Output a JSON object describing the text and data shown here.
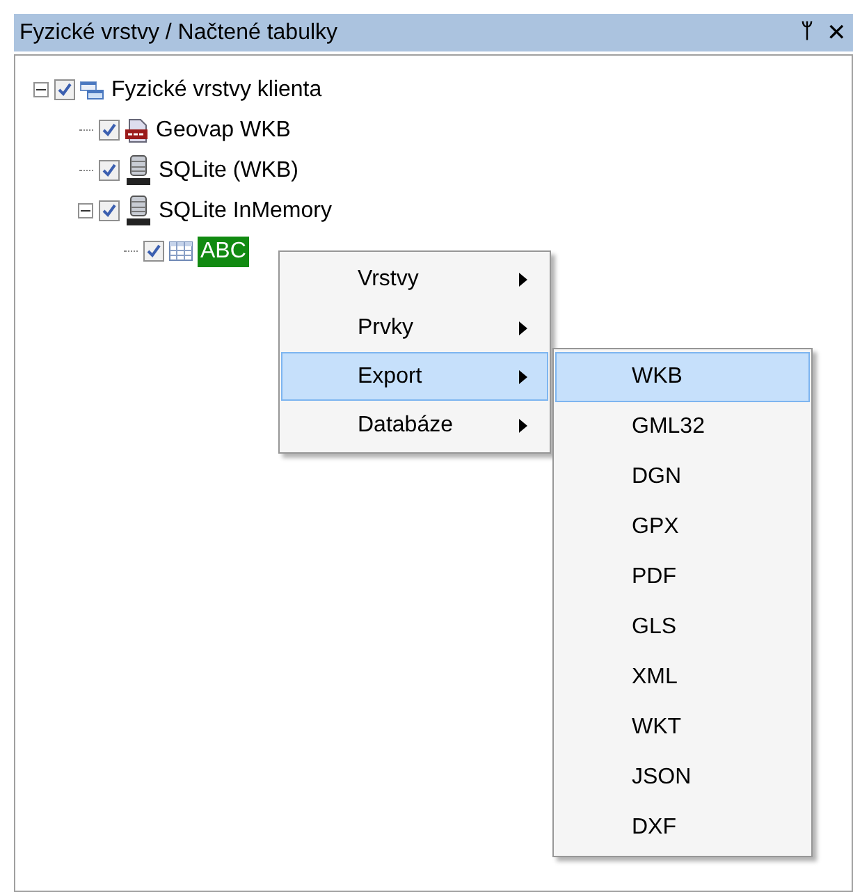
{
  "panel": {
    "title": "Fyzické vrstvy / Načtené tabulky",
    "pin_icon": "ᛘ",
    "close_icon": "✕"
  },
  "tree": [
    {
      "label": "Fyzické vrstvy klienta",
      "kind": "layers",
      "checked": true,
      "selected": false,
      "expanded": true,
      "children": [
        {
          "label": "Geovap WKB",
          "kind": "wkb",
          "checked": true,
          "selected": false
        },
        {
          "label": "SQLite (WKB)",
          "kind": "sqlite",
          "checked": true,
          "selected": false
        },
        {
          "label": "SQLite InMemory",
          "kind": "sqlite",
          "checked": true,
          "selected": false,
          "expanded": true,
          "children": [
            {
              "label": "ABC",
              "kind": "table",
              "checked": true,
              "selected": true
            }
          ]
        }
      ]
    }
  ],
  "context_menu": [
    {
      "label": "Vrstvy",
      "selected": false
    },
    {
      "label": "Prvky",
      "selected": false
    },
    {
      "label": "Export",
      "selected": true
    },
    {
      "label": "Databáze",
      "selected": false
    }
  ],
  "submenu": [
    {
      "label": "WKB",
      "selected": true
    },
    {
      "label": "GML32",
      "selected": false
    },
    {
      "label": "DGN",
      "selected": false
    },
    {
      "label": "GPX",
      "selected": false
    },
    {
      "label": "PDF",
      "selected": false
    },
    {
      "label": "GLS",
      "selected": false
    },
    {
      "label": "XML",
      "selected": false
    },
    {
      "label": "WKT",
      "selected": false
    },
    {
      "label": "JSON",
      "selected": false
    },
    {
      "label": "DXF",
      "selected": false
    }
  ]
}
